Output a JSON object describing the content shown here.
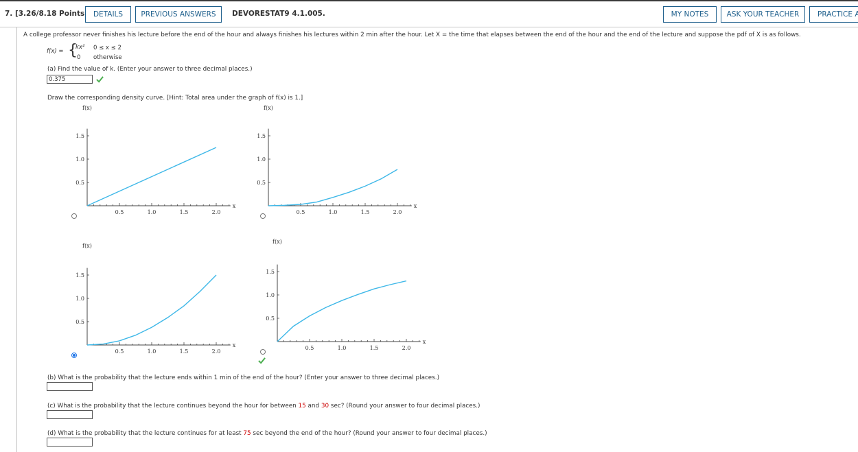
{
  "header": {
    "question_label": "7.  [3.26/8.18 Points]",
    "details_btn": "DETAILS",
    "prev_btn": "PREVIOUS ANSWERS",
    "code": "DEVORESTAT9 4.1.005.",
    "notes_btn": "MY NOTES",
    "ask_btn": "ASK YOUR TEACHER",
    "practice_btn": "PRACTICE A"
  },
  "problem": {
    "statement": "A college professor never finishes his lecture before the end of the hour and always finishes his lectures within 2 min after the hour. Let X = the time that elapses between the end of the hour and the end of the lecture and suppose the pdf of X is as follows.",
    "fx_label": "f(x) =",
    "case1_expr": "kx²",
    "case1_cond": "0 ≤ x ≤ 2",
    "case2_expr": "0",
    "case2_cond": "otherwise"
  },
  "part_a": {
    "question": "(a) Find the value of k. (Enter your answer to three decimal places.)",
    "answer": "0.375"
  },
  "draw": {
    "instruction": "Draw the corresponding density curve. [Hint: Total area under the graph of f(x) is 1.]"
  },
  "graphs": {
    "y_label": "f(x)",
    "x_label": "x",
    "origin": "0",
    "x_ticks": [
      "0.5",
      "1.0",
      "1.5",
      "2.0"
    ],
    "y_ticks": [
      "0.5",
      "1.0",
      "1.5"
    ],
    "line_color": "#3fb8e8",
    "selected_option": 3
  },
  "chart_data": [
    {
      "type": "line",
      "option": 1,
      "x": [
        0,
        2
      ],
      "y": [
        0,
        1.25
      ],
      "xlim": [
        0,
        2.2
      ],
      "ylim": [
        0,
        1.8
      ],
      "selected": false
    },
    {
      "type": "line",
      "option": 2,
      "x": [
        0,
        0.25,
        0.5,
        0.75,
        1,
        1.25,
        1.5,
        1.75,
        2
      ],
      "y": [
        0,
        0.01,
        0.03,
        0.08,
        0.18,
        0.29,
        0.42,
        0.58,
        0.78
      ],
      "xlim": [
        0,
        2.2
      ],
      "ylim": [
        0,
        1.8
      ],
      "selected": false
    },
    {
      "type": "line",
      "option": 3,
      "x": [
        0,
        0.25,
        0.5,
        0.75,
        1,
        1.25,
        1.5,
        1.75,
        2
      ],
      "y": [
        0,
        0.02,
        0.09,
        0.21,
        0.38,
        0.59,
        0.84,
        1.15,
        1.5
      ],
      "xlim": [
        0,
        2.2
      ],
      "ylim": [
        0,
        1.8
      ],
      "selected": true
    },
    {
      "type": "line",
      "option": 4,
      "x": [
        0,
        0.25,
        0.5,
        0.75,
        1,
        1.25,
        1.5,
        1.75,
        2
      ],
      "y": [
        0,
        0.33,
        0.55,
        0.73,
        0.88,
        1.01,
        1.13,
        1.22,
        1.3
      ],
      "xlim": [
        0,
        2.2
      ],
      "ylim": [
        0,
        1.8
      ],
      "selected": false
    }
  ],
  "part_b": {
    "question": "(b) What is the probability that the lecture ends within 1 min of the end of the hour? (Enter your answer to three decimal places.)"
  },
  "part_c": {
    "q_pre": "(c) What is the probability that the lecture continues beyond the hour for between ",
    "q_n1": "15",
    "q_mid": " and ",
    "q_n2": "30",
    "q_post": " sec? (Round your answer to four decimal places.)"
  },
  "part_d": {
    "q_pre": "(d) What is the probability that the lecture continues for at least ",
    "q_n1": "75",
    "q_post": " sec beyond the end of the hour? (Round your answer to four decimal places.)"
  }
}
